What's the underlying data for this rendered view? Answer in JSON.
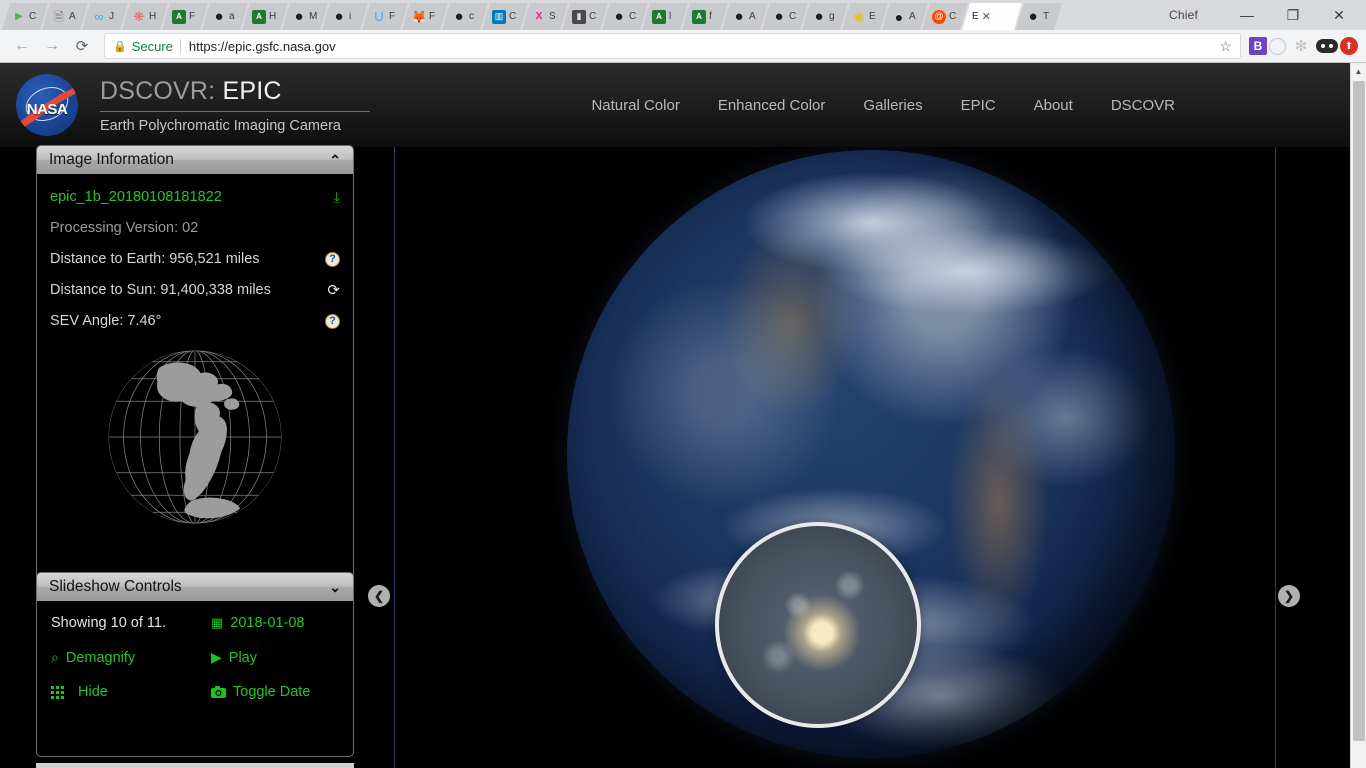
{
  "browser": {
    "profile_name": "Chief",
    "window_controls": {
      "minimize": "—",
      "maximize": "❐",
      "close": "✕"
    },
    "toolbar": {
      "back_icon": "←",
      "forward_icon": "→",
      "reload_icon": "⟳",
      "lock_icon": "🔒",
      "secure_label": "Secure",
      "url": "https://epic.gsfc.nasa.gov",
      "bookmark_star_icon": "☆"
    },
    "extensions": [
      {
        "name": "bootstrap-extension",
        "label": "B"
      },
      {
        "name": "circle-extension",
        "label": ""
      },
      {
        "name": "gear-extension",
        "label": "✻"
      },
      {
        "name": "oval-extension",
        "label": ""
      },
      {
        "name": "red-extension",
        "label": "⬆"
      }
    ],
    "tabs": [
      {
        "fav": "fav-play",
        "glyph": "▶",
        "label": "C"
      },
      {
        "fav": "fav-doc",
        "glyph": "🗎",
        "label": "A"
      },
      {
        "fav": "fav-blue",
        "glyph": "∞",
        "label": "J"
      },
      {
        "fav": "fav-red",
        "glyph": "❋",
        "label": "H"
      },
      {
        "fav": "fav-green",
        "glyph": "A",
        "label": "F"
      },
      {
        "fav": "fav-gh",
        "glyph": "●",
        "label": "a"
      },
      {
        "fav": "fav-green",
        "glyph": "A",
        "label": "H"
      },
      {
        "fav": "fav-gh",
        "glyph": "●",
        "label": "M"
      },
      {
        "fav": "fav-gh",
        "glyph": "●",
        "label": "i"
      },
      {
        "fav": "fav-blue",
        "glyph": "U",
        "label": "F"
      },
      {
        "fav": "fav-orange",
        "glyph": "🦊",
        "label": "F"
      },
      {
        "fav": "fav-gh",
        "glyph": "●",
        "label": "c"
      },
      {
        "fav": "fav-trello",
        "glyph": "▥",
        "label": "C"
      },
      {
        "fav": "fav-pink",
        "glyph": "X",
        "label": "S"
      },
      {
        "fav": "fav-dark",
        "glyph": "▮",
        "label": "C"
      },
      {
        "fav": "fav-gh",
        "glyph": "●",
        "label": "C"
      },
      {
        "fav": "fav-green",
        "glyph": "A",
        "label": "l"
      },
      {
        "fav": "fav-green",
        "glyph": "A",
        "label": "f"
      },
      {
        "fav": "fav-gh",
        "glyph": "●",
        "label": "A"
      },
      {
        "fav": "fav-gh",
        "glyph": "●",
        "label": "C"
      },
      {
        "fav": "fav-gh",
        "glyph": "●",
        "label": "g"
      },
      {
        "fav": "fav-yellow",
        "glyph": "◉",
        "label": "E"
      },
      {
        "fav": "fav-check",
        "glyph": "●",
        "label": "A"
      },
      {
        "fav": "fav-reddit",
        "glyph": "@",
        "label": "C"
      },
      {
        "fav": "",
        "glyph": "",
        "label": "E",
        "active": true,
        "close_icon": "✕"
      },
      {
        "fav": "fav-gh",
        "glyph": "●",
        "label": "T"
      }
    ]
  },
  "site": {
    "logo_word": "NASA",
    "title_prefix": "DSCOVR: ",
    "title_main": "EPIC",
    "subtitle": "Earth Polychromatic Imaging Camera",
    "nav": [
      {
        "label": "Natural Color"
      },
      {
        "label": "Enhanced Color"
      },
      {
        "label": "Galleries"
      },
      {
        "label": "EPIC"
      },
      {
        "label": "About"
      },
      {
        "label": "DSCOVR"
      }
    ]
  },
  "image_info": {
    "panel_title": "Image Information",
    "collapse_icon": "⌃",
    "image_id": "epic_1b_20180108181822",
    "download_icon": "⤓",
    "processing_version": "Processing Version: 02",
    "distance_to_earth": "Distance to Earth: 956,521 miles",
    "distance_to_earth_help_icon": "?",
    "distance_to_sun": "Distance to Sun: 91,400,338 miles",
    "distance_to_sun_sync_icon": "⟳",
    "sev_angle": "SEV Angle: 7.46°",
    "sev_angle_help_icon": "?",
    "globe_alt": "centroid-globe"
  },
  "slideshow": {
    "panel_title": "Slideshow Controls",
    "expand_icon": "⌄",
    "showing": "Showing 10 of 11.",
    "date": "2018-01-08",
    "date_icon": "▦",
    "demagnify": "Demagnify",
    "demagnify_icon": "⌕",
    "play": "Play",
    "play_icon": "▶",
    "hide": "Hide",
    "hide_icon": "",
    "toggle_date": "Toggle Date",
    "toggle_date_icon": "⬤"
  },
  "viewer": {
    "prev_icon": "❮",
    "next_icon": "❯",
    "earth_alt": "earth-from-dscovr",
    "magnifier_alt": "magnifier-sunglint"
  },
  "scrollbar": {
    "up_icon": "▲"
  }
}
